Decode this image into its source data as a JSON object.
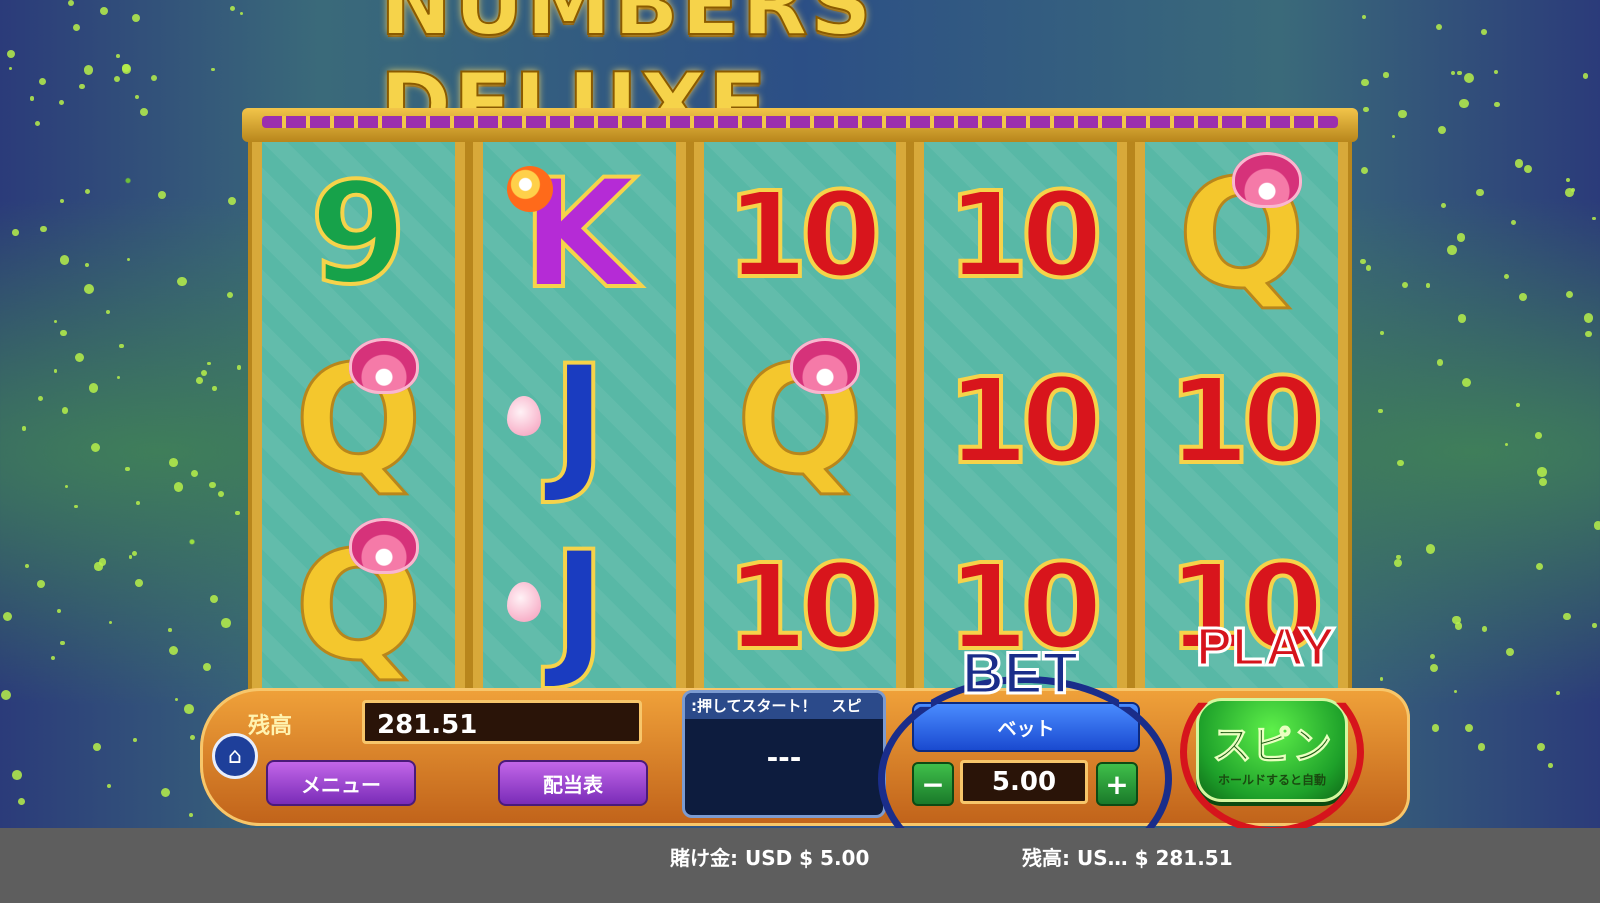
{
  "game": {
    "title": "NUMBERS DELUXE"
  },
  "reels": [
    [
      "9",
      "Q",
      "Q"
    ],
    [
      "K",
      "J",
      "J"
    ],
    [
      "10",
      "Q",
      "10"
    ],
    [
      "10",
      "10",
      "10"
    ],
    [
      "Q",
      "10",
      "10"
    ]
  ],
  "panel": {
    "balance_label": "残高",
    "balance_value": "281.51",
    "home_icon": "home-icon",
    "menu_label": "メニュー",
    "paytable_label": "配当表",
    "ticker_text": ":押してスタート！　スピ",
    "ticker_value": "---",
    "bet_label": "ベット",
    "bet_value": "5.00",
    "minus_label": "−",
    "plus_label": "+",
    "spin_label": "スピン",
    "spin_sub": "ホールドすると自動"
  },
  "annotations": {
    "bet": "BET",
    "play": "PLAY"
  },
  "status": {
    "bet_text": "賭け金:  USD $ 5.00",
    "balance_text": "残高:  US… $ 281.51"
  },
  "colors": {
    "accent_blue": "#1a2d8a",
    "accent_red": "#d6141c",
    "spin_green": "#1ea12a"
  }
}
